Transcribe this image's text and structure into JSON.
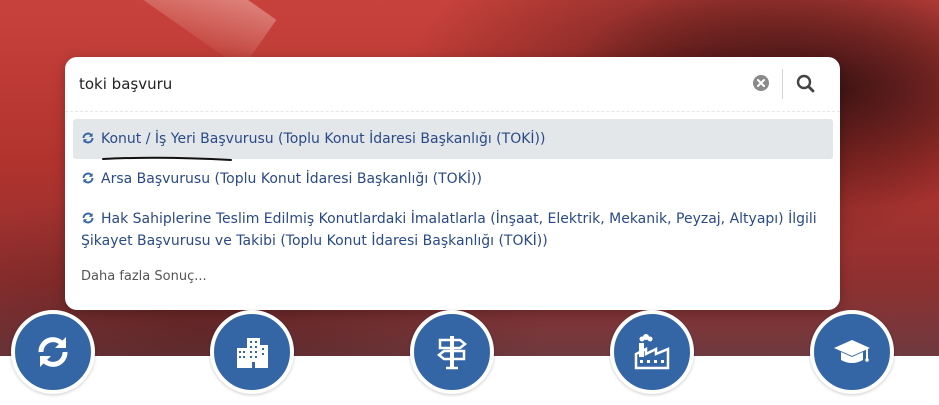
{
  "search": {
    "value": "toki başvuru",
    "clear_icon": "clear-circle-x-icon",
    "submit_icon": "search-icon"
  },
  "results": [
    {
      "label": "Konut / İş Yeri Başvurusu (Toplu Konut İdaresi Başkanlığı (TOKİ))",
      "icon": "refresh-icon",
      "active": true
    },
    {
      "label": "Arsa Başvurusu (Toplu Konut İdaresi Başkanlığı (TOKİ))",
      "icon": "refresh-icon",
      "active": false
    },
    {
      "label": "Hak Sahiplerine Teslim Edilmiş Konutlardaki İmalatlarla (İnşaat, Elektrik, Mekanik, Peyzaj, Altyapı) İlgili Şikayet Başvurusu ve Takibi (Toplu Konut İdaresi Başkanlığı (TOKİ))",
      "icon": "refresh-icon",
      "active": false
    }
  ],
  "more_label": "Daha fazla Sonuç...",
  "category_icons": [
    "refresh-icon",
    "buildings-icon",
    "signpost-icon",
    "factory-icon",
    "graduation-cap-icon"
  ],
  "colors": {
    "accent": "#3466a6",
    "link": "#2a4a86",
    "active_row": "#e4e7ea",
    "hero": "#b2332e"
  }
}
